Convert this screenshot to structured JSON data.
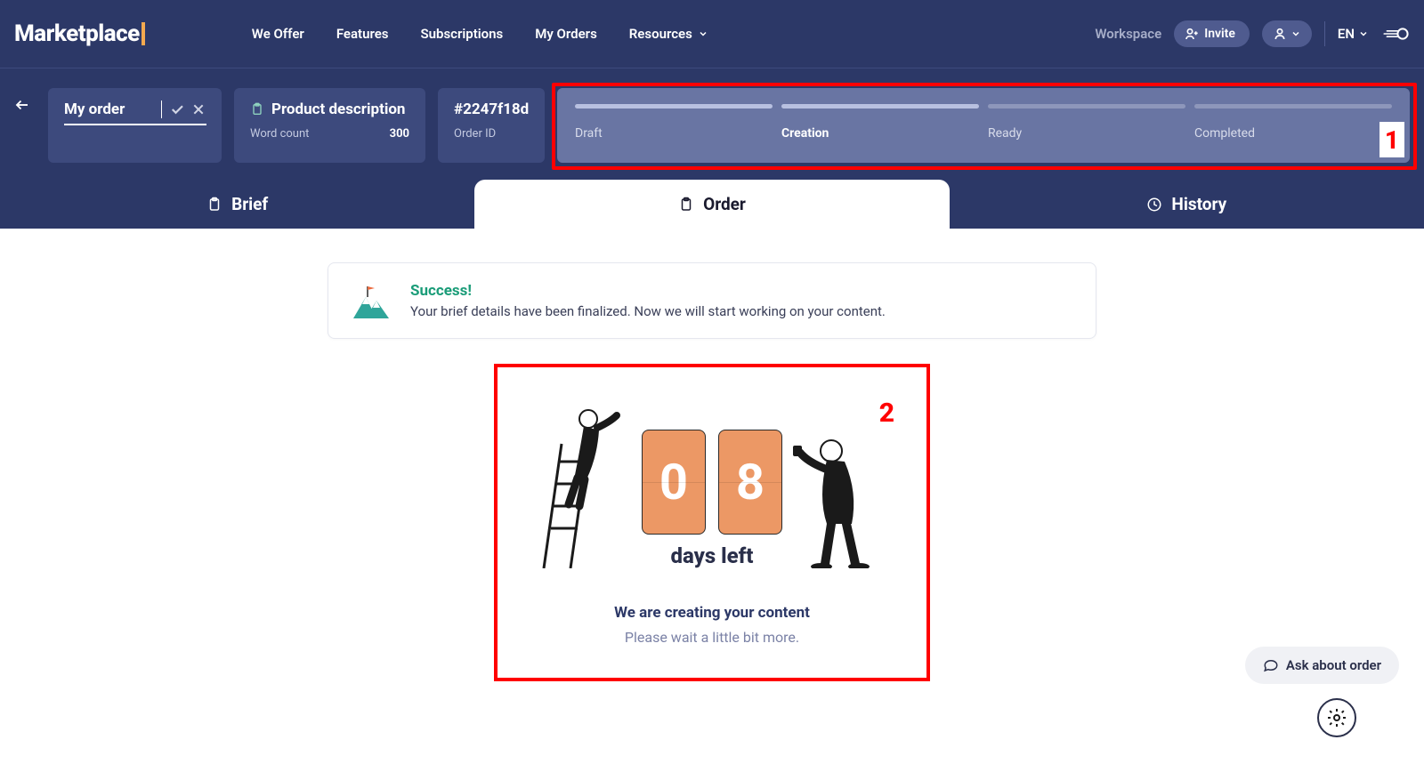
{
  "header": {
    "logo": "Marketplace",
    "nav": {
      "we_offer": "We Offer",
      "features": "Features",
      "subscriptions": "Subscriptions",
      "my_orders": "My Orders",
      "resources": "Resources"
    },
    "workspace": "Workspace",
    "invite": "Invite",
    "lang": "EN"
  },
  "subheader": {
    "order_name": "My order",
    "product": {
      "title": "Product description",
      "word_count_label": "Word count",
      "word_count_value": "300"
    },
    "order_id": {
      "label": "Order ID",
      "value": "#2247f18d"
    },
    "steps": {
      "draft": "Draft",
      "creation": "Creation",
      "ready": "Ready",
      "completed": "Completed"
    }
  },
  "tabs": {
    "brief": "Brief",
    "order": "Order",
    "history": "History"
  },
  "success": {
    "title": "Success!",
    "text": "Your brief details have been finalized. Now we will start working on your content."
  },
  "countdown": {
    "digit1": "0",
    "digit2": "8",
    "days_left": "days left",
    "creating_title": "We are creating your content",
    "creating_sub": "Please wait a little bit more."
  },
  "ask_button": "Ask about order",
  "annotations": {
    "one": "1",
    "two": "2"
  }
}
